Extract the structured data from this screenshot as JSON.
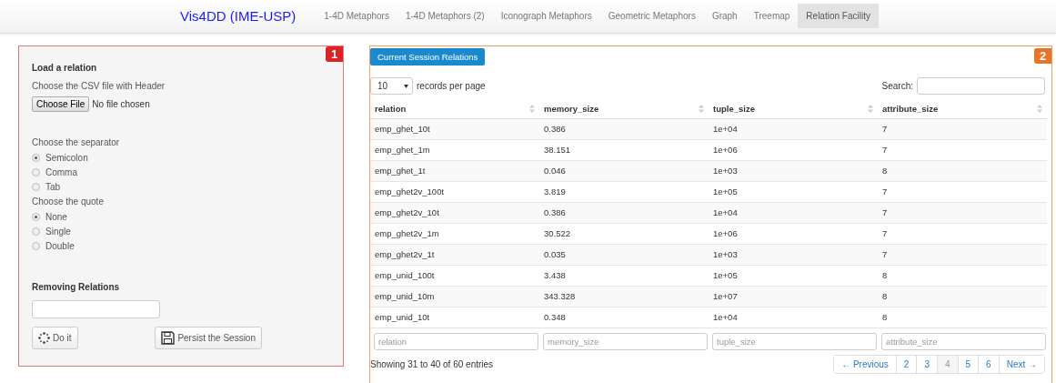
{
  "navbar": {
    "brand": "Vis4DD (IME-USP)",
    "items": [
      {
        "label": "1-4D Metaphors",
        "selected": false
      },
      {
        "label": "1-4D Metaphors (2)",
        "selected": false
      },
      {
        "label": "Iconograph Metaphors",
        "selected": false
      },
      {
        "label": "Geometric Metaphors",
        "selected": false
      },
      {
        "label": "Graph",
        "selected": false
      },
      {
        "label": "Treemap",
        "selected": false
      },
      {
        "label": "Relation Facility",
        "selected": true
      }
    ]
  },
  "load_panel": {
    "badge": "1",
    "title": "Load a relation",
    "file_label": "Choose the CSV file with Header",
    "file_button": "Choose File",
    "file_status": "No file chosen",
    "separator": {
      "label": "Choose the separator",
      "options": [
        {
          "label": "Semicolon",
          "selected": true
        },
        {
          "label": "Comma",
          "selected": false
        },
        {
          "label": "Tab",
          "selected": false
        }
      ]
    },
    "quote": {
      "label": "Choose the quote",
      "options": [
        {
          "label": "None",
          "selected": true
        },
        {
          "label": "Single",
          "selected": false
        },
        {
          "label": "Double",
          "selected": false
        }
      ]
    },
    "remove_title": "Removing Relations",
    "do_button": "Do it",
    "persist_button": "Persist the Session"
  },
  "relations_panel": {
    "badge": "2",
    "title": "Current Session Relations",
    "page_size": "10",
    "page_size_label": "records per page",
    "search_label": "Search:",
    "columns": [
      "relation",
      "memory_size",
      "tuple_size",
      "attribute_size"
    ],
    "rows": [
      [
        "emp_ghet_10t",
        "0.386",
        "1e+04",
        "7"
      ],
      [
        "emp_ghet_1m",
        "38.151",
        "1e+06",
        "7"
      ],
      [
        "emp_ghet_1t",
        "0.046",
        "1e+03",
        "8"
      ],
      [
        "emp_ghet2v_100t",
        "3.819",
        "1e+05",
        "7"
      ],
      [
        "emp_ghet2v_10t",
        "0.386",
        "1e+04",
        "7"
      ],
      [
        "emp_ghet2v_1m",
        "30.522",
        "1e+06",
        "7"
      ],
      [
        "emp_ghet2v_1t",
        "0.035",
        "1e+03",
        "7"
      ],
      [
        "emp_unid_100t",
        "3.438",
        "1e+05",
        "8"
      ],
      [
        "emp_unid_10m",
        "343.328",
        "1e+07",
        "8"
      ],
      [
        "emp_unid_10t",
        "0.348",
        "1e+04",
        "8"
      ]
    ],
    "filters": [
      {
        "placeholder": "relation"
      },
      {
        "placeholder": "memory_size"
      },
      {
        "placeholder": "tuple_size"
      },
      {
        "placeholder": "attribute_size"
      }
    ],
    "info": "Showing 31 to 40 of 60 entries",
    "pagination": [
      {
        "label": "← Previous",
        "selected": false
      },
      {
        "label": "2",
        "selected": false
      },
      {
        "label": "3",
        "selected": false
      },
      {
        "label": "4",
        "selected": true
      },
      {
        "label": "5",
        "selected": false
      },
      {
        "label": "6",
        "selected": false
      },
      {
        "label": "Next →",
        "selected": false
      }
    ]
  }
}
